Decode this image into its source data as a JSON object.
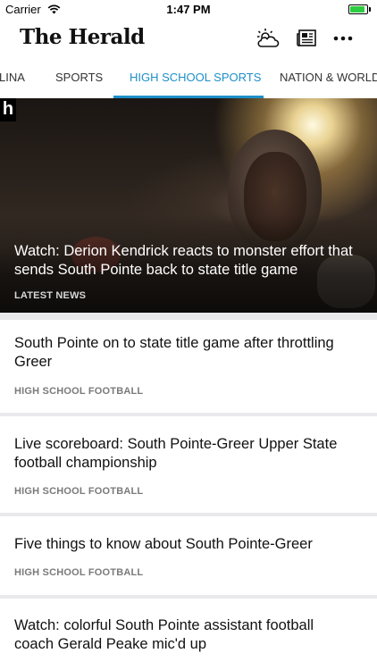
{
  "status": {
    "carrier": "Carrier",
    "time": "1:47 PM",
    "battery_level": 0.9
  },
  "appbar": {
    "brand": "The Herald",
    "icons": [
      "weather-icon",
      "newspaper-icon",
      "more-icon"
    ]
  },
  "tabs": [
    {
      "label": "LINA",
      "active": false
    },
    {
      "label": "SPORTS",
      "active": false
    },
    {
      "label": "HIGH SCHOOL SPORTS",
      "active": true
    },
    {
      "label": "NATION & WORLD",
      "active": false
    }
  ],
  "colors": {
    "accent": "#1e8fc9",
    "category": "#7a7a7a",
    "background": "#e9e9ec"
  },
  "hero": {
    "badge": "h",
    "title": "Watch: Derion Kendrick reacts to monster effort that sends South Pointe back to state title game",
    "category": "LATEST NEWS"
  },
  "articles": [
    {
      "title": "South Pointe on to state title game after throttling Greer",
      "category": "HIGH SCHOOL FOOTBALL"
    },
    {
      "title": "Live scoreboard: South Pointe-Greer Upper State football championship",
      "category": "HIGH SCHOOL FOOTBALL"
    },
    {
      "title": "Five things to know about South Pointe-Greer",
      "category": "HIGH SCHOOL FOOTBALL"
    },
    {
      "title": "Watch: colorful South Pointe assistant football coach Gerald Peake mic'd up",
      "category": ""
    }
  ]
}
